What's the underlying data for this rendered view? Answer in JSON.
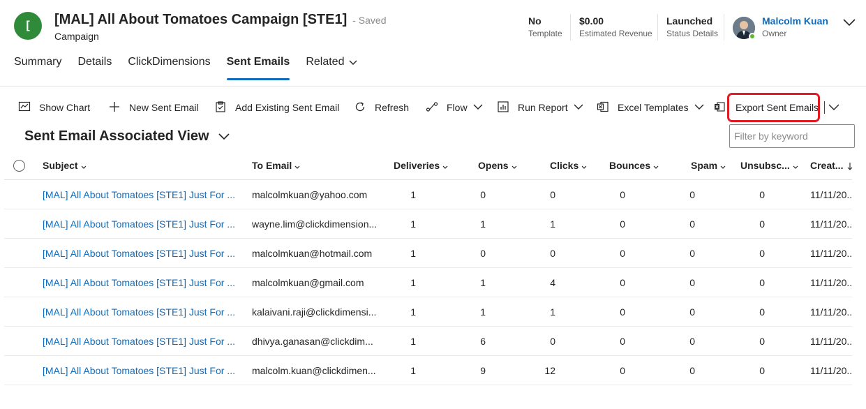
{
  "record": {
    "initial": "[",
    "title": "[MAL] All About Tomatoes Campaign [STE1]",
    "save_status": "- Saved",
    "entity": "Campaign"
  },
  "header_fields": [
    {
      "value": "No",
      "label": "Template"
    },
    {
      "value": "$0.00",
      "label": "Estimated Revenue"
    },
    {
      "value": "Launched",
      "label": "Status Details"
    }
  ],
  "owner": {
    "name": "Malcolm Kuan",
    "label": "Owner"
  },
  "tabs": [
    {
      "label": "Summary"
    },
    {
      "label": "Details"
    },
    {
      "label": "ClickDimensions"
    },
    {
      "label": "Sent Emails"
    },
    {
      "label": "Related"
    }
  ],
  "commands": {
    "show_chart": "Show Chart",
    "new_sent_email": "New Sent Email",
    "add_existing": "Add Existing Sent Email",
    "refresh": "Refresh",
    "flow": "Flow",
    "run_report": "Run Report",
    "excel_templates": "Excel Templates",
    "export_sent_emails": "Export Sent Emails"
  },
  "view": {
    "title": "Sent Email Associated View"
  },
  "filter": {
    "placeholder": "Filter by keyword"
  },
  "columns": [
    "Subject",
    "To Email",
    "Deliveries",
    "Opens",
    "Clicks",
    "Bounces",
    "Spam",
    "Unsubsc...",
    "Creat..."
  ],
  "rows": [
    {
      "subject": "[MAL] All About Tomatoes [STE1] Just For ...",
      "to": "malcolmkuan@yahoo.com",
      "deliveries": "1",
      "opens": "0",
      "clicks": "0",
      "bounces": "0",
      "spam": "0",
      "unsub": "0",
      "created": "11/11/20..."
    },
    {
      "subject": "[MAL] All About Tomatoes [STE1] Just For ...",
      "to": "wayne.lim@clickdimension...",
      "deliveries": "1",
      "opens": "1",
      "clicks": "1",
      "bounces": "0",
      "spam": "0",
      "unsub": "0",
      "created": "11/11/20..."
    },
    {
      "subject": "[MAL] All About Tomatoes [STE1] Just For ...",
      "to": "malcolmkuan@hotmail.com",
      "deliveries": "1",
      "opens": "0",
      "clicks": "0",
      "bounces": "0",
      "spam": "0",
      "unsub": "0",
      "created": "11/11/20..."
    },
    {
      "subject": "[MAL] All About Tomatoes [STE1] Just For ...",
      "to": "malcolmkuan@gmail.com",
      "deliveries": "1",
      "opens": "1",
      "clicks": "4",
      "bounces": "0",
      "spam": "0",
      "unsub": "0",
      "created": "11/11/20..."
    },
    {
      "subject": "[MAL] All About Tomatoes [STE1] Just For ...",
      "to": "kalaivani.raji@clickdimensi...",
      "deliveries": "1",
      "opens": "1",
      "clicks": "1",
      "bounces": "0",
      "spam": "0",
      "unsub": "0",
      "created": "11/11/20..."
    },
    {
      "subject": "[MAL] All About Tomatoes [STE1] Just For ...",
      "to": "dhivya.ganasan@clickdim...",
      "deliveries": "1",
      "opens": "6",
      "clicks": "0",
      "bounces": "0",
      "spam": "0",
      "unsub": "0",
      "created": "11/11/20..."
    },
    {
      "subject": "[MAL] All About Tomatoes [STE1] Just For ...",
      "to": "malcolm.kuan@clickdimen...",
      "deliveries": "1",
      "opens": "9",
      "clicks": "12",
      "bounces": "0",
      "spam": "0",
      "unsub": "0",
      "created": "11/11/20..."
    }
  ],
  "colors": {
    "accent": "#0f6cbd",
    "avatar": "#2f8b3a",
    "highlight": "#e01b24",
    "presence": "#5fb82f"
  }
}
